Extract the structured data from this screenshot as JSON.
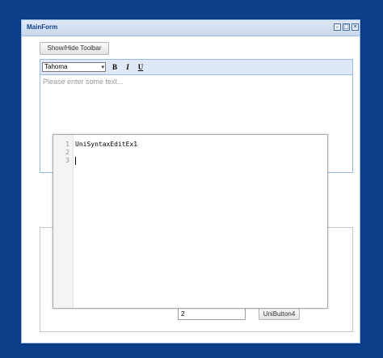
{
  "window": {
    "title": "MainForm",
    "controls": {
      "minimize": "–",
      "maximize": "□",
      "close": "✕"
    }
  },
  "toolbar_toggle": {
    "label": "Show/Hide Toolbar"
  },
  "memo": {
    "font_select": {
      "value": "Tahoma"
    },
    "format": {
      "bold": "B",
      "italic": "I",
      "underline": "U"
    },
    "placeholder": "Please enter some text..."
  },
  "syntax_editor": {
    "line_numbers": [
      "1",
      "2",
      "3"
    ],
    "lines": [
      "UniSyntaxEditEx1",
      "",
      ""
    ]
  },
  "edit": {
    "value": "2"
  },
  "button4": {
    "label": "UniButton4"
  },
  "colors": {
    "desktop": "#0b3f8a",
    "title_text": "#15428b",
    "border": "#99bbe8",
    "toolbar_bg": "#dfe8f6"
  }
}
